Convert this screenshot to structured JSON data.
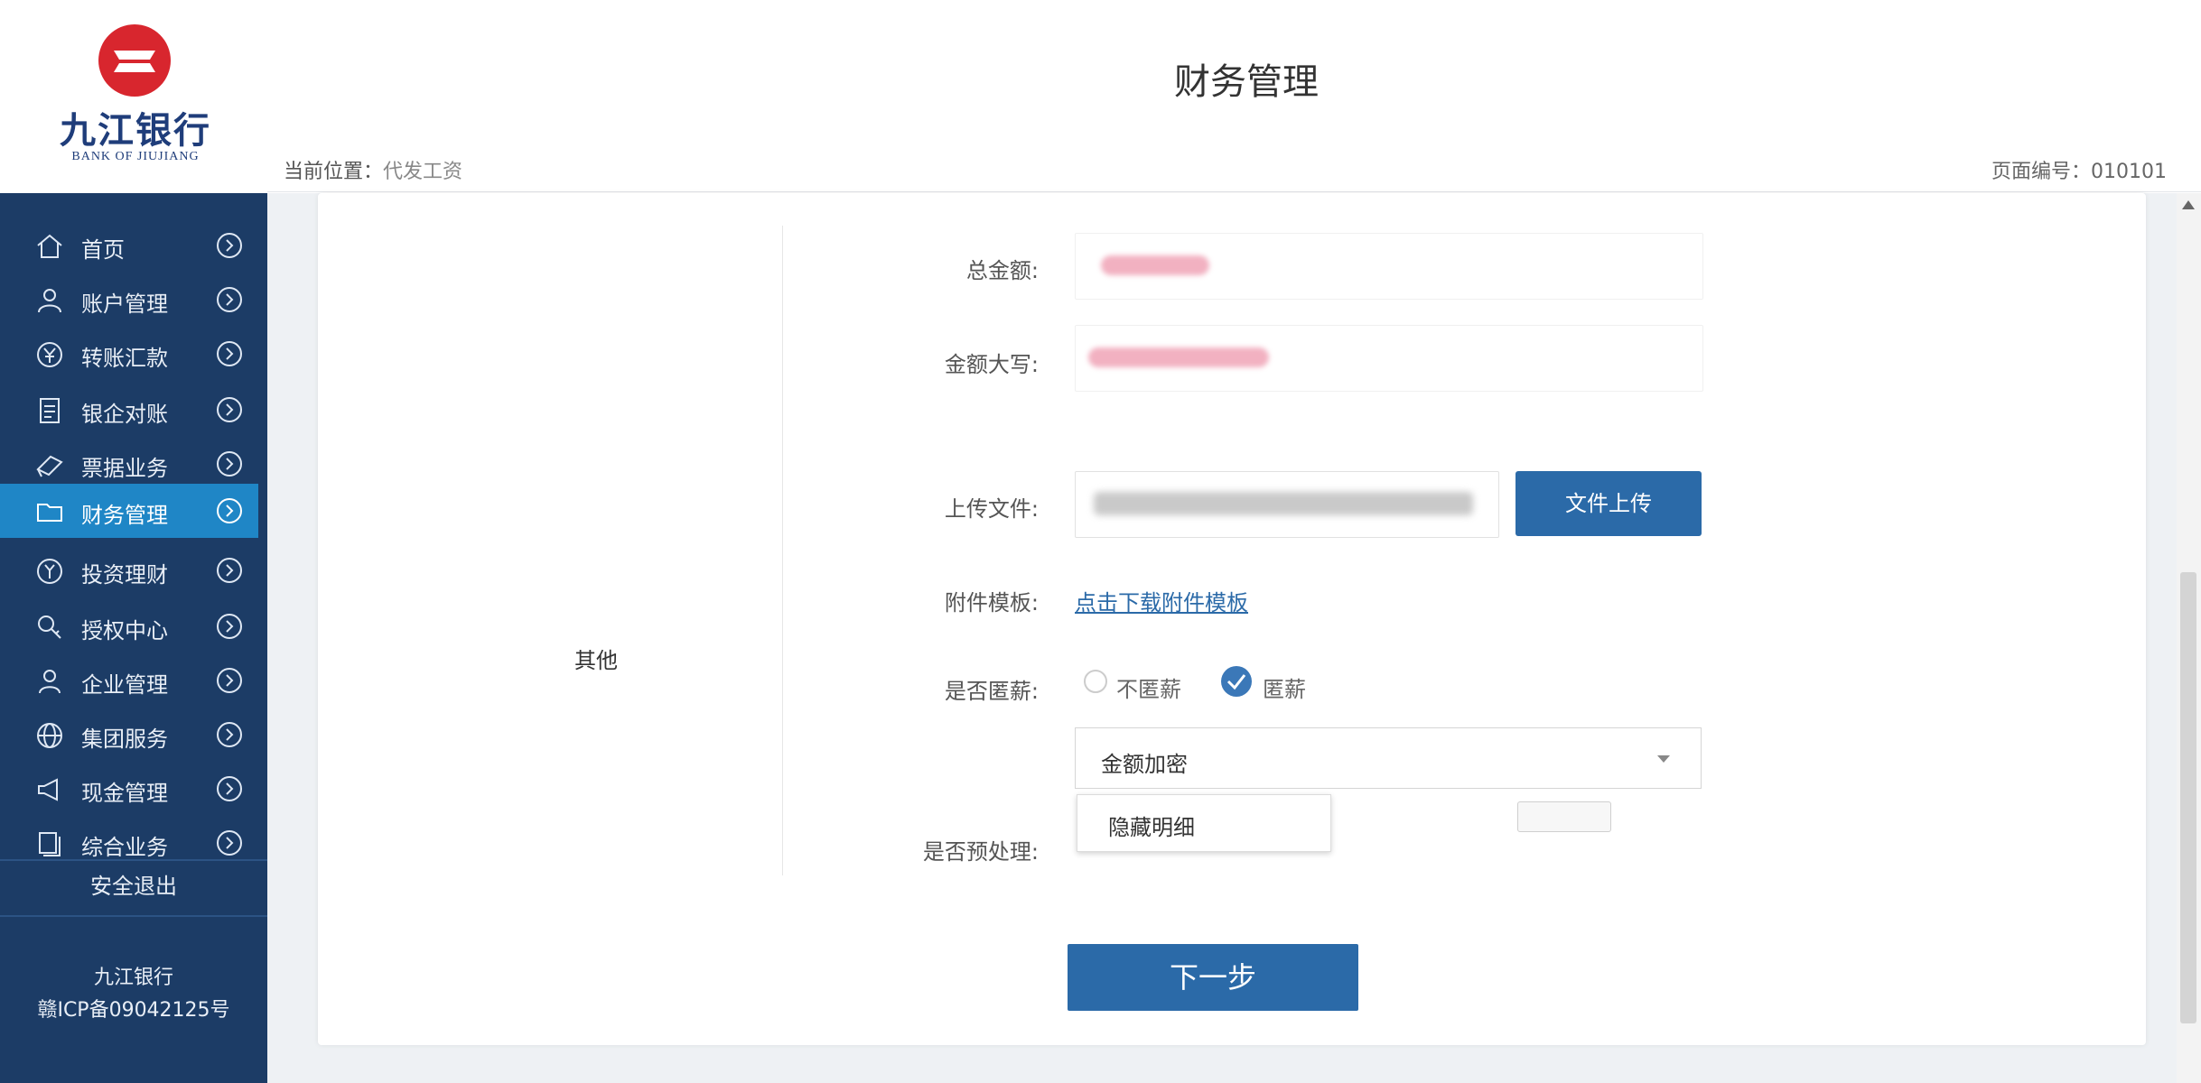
{
  "app": {
    "page_title": "财务管理",
    "brand_name_cn": "九江银行",
    "brand_name_en": "BANK OF JIUJIANG"
  },
  "breadcrumb": {
    "label": "当前位置：",
    "value": "代发工资"
  },
  "page_number": {
    "label": "页面编号：",
    "value": "010101"
  },
  "sidebar": {
    "items": [
      {
        "label": "首页",
        "icon": "home-icon"
      },
      {
        "label": "账户管理",
        "icon": "user-icon"
      },
      {
        "label": "转账汇款",
        "icon": "currency-icon"
      },
      {
        "label": "银企对账",
        "icon": "document-icon"
      },
      {
        "label": "票据业务",
        "icon": "ticket-icon"
      },
      {
        "label": "财务管理",
        "icon": "folder-icon",
        "active": true
      },
      {
        "label": "投资理财",
        "icon": "yen-icon"
      },
      {
        "label": "授权中心",
        "icon": "key-icon"
      },
      {
        "label": "企业管理",
        "icon": "person-icon"
      },
      {
        "label": "集团服务",
        "icon": "globe-icon"
      },
      {
        "label": "现金管理",
        "icon": "megaphone-icon"
      },
      {
        "label": "综合业务",
        "icon": "stack-icon"
      }
    ],
    "logout": "安全退出",
    "footer_line1": "九江银行",
    "footer_line2": "赣ICP备09042125号"
  },
  "form": {
    "section_label": "其他",
    "total_amount_label": "总金额:",
    "amount_upper_label": "金额大写:",
    "upload_file_label": "上传文件:",
    "upload_button": "文件上传",
    "attachment_template_label": "附件模板:",
    "attachment_template_link": "点击下载附件模板",
    "encrypt_label": "是否匿薪:",
    "encrypt_option_no": "不匿薪",
    "encrypt_option_yes": "匿薪",
    "encrypt_method_selected": "金额加密",
    "dropdown_option": "隐藏明细",
    "preprocess_label": "是否预处理:",
    "next_button": "下一步"
  },
  "colors": {
    "sidebar_bg": "#1c3c66",
    "sidebar_active": "#1f86c6",
    "primary_button": "#2b6aa8",
    "logo_red": "#d8262e"
  }
}
